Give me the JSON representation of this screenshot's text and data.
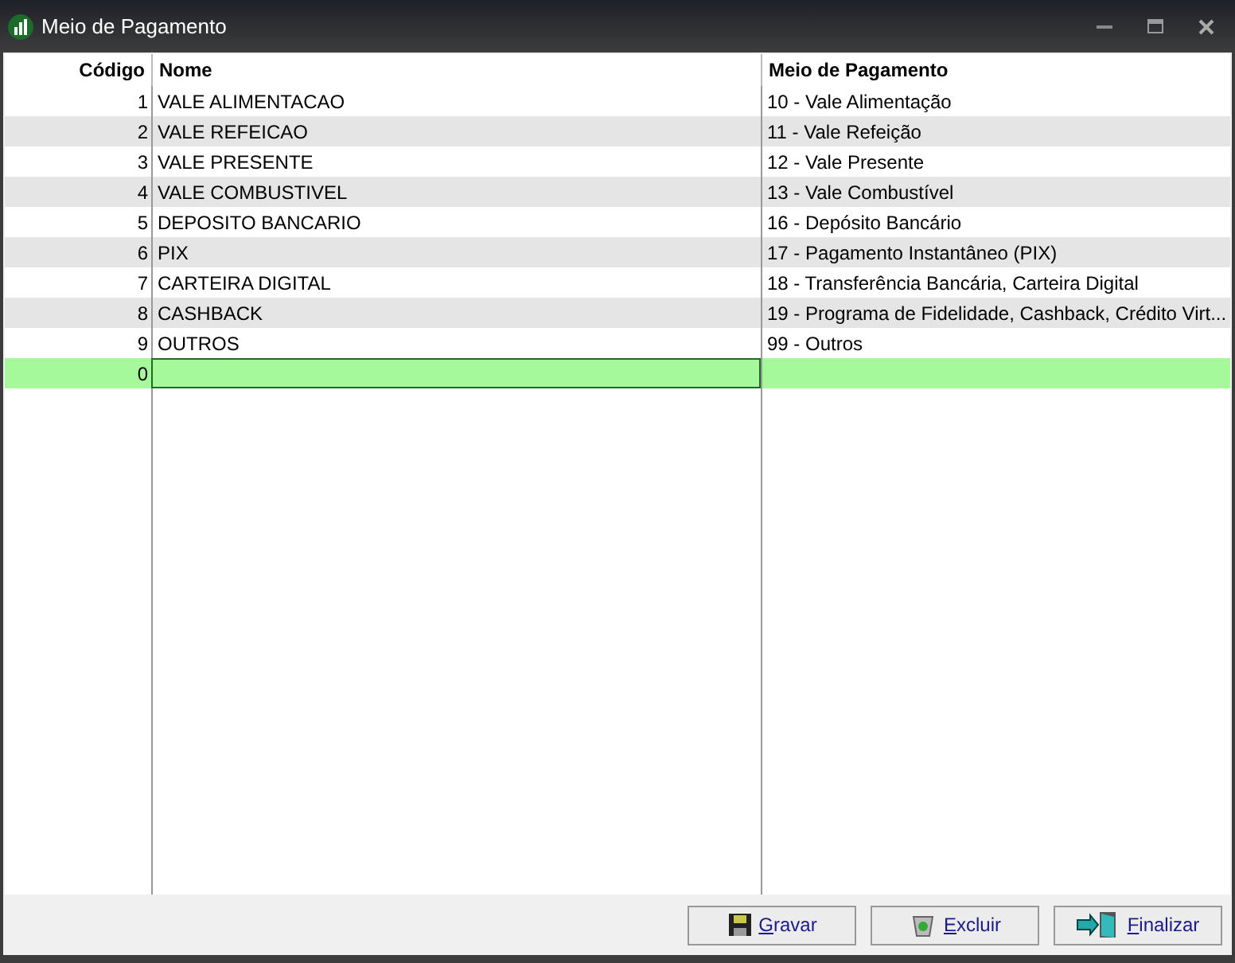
{
  "window": {
    "title": "Meio de Pagamento"
  },
  "table": {
    "columns": [
      "Código",
      "Nome",
      "Meio de Pagamento"
    ],
    "rows": [
      {
        "codigo": "1",
        "nome": "VALE ALIMENTACAO",
        "meio": "10 - Vale Alimentação",
        "selected": false
      },
      {
        "codigo": "2",
        "nome": "VALE REFEICAO",
        "meio": "11 - Vale Refeição",
        "selected": false
      },
      {
        "codigo": "3",
        "nome": "VALE PRESENTE",
        "meio": "12 - Vale Presente",
        "selected": false
      },
      {
        "codigo": "4",
        "nome": "VALE COMBUSTIVEL",
        "meio": "13 - Vale Combustível",
        "selected": false
      },
      {
        "codigo": "5",
        "nome": "DEPOSITO BANCARIO",
        "meio": "16 - Depósito Bancário",
        "selected": false
      },
      {
        "codigo": "6",
        "nome": "PIX",
        "meio": "17 - Pagamento Instantâneo (PIX)",
        "selected": false
      },
      {
        "codigo": "7",
        "nome": "CARTEIRA DIGITAL",
        "meio": "18 - Transferência Bancária, Carteira Digital",
        "selected": false
      },
      {
        "codigo": "8",
        "nome": "CASHBACK",
        "meio": "19 - Programa de Fidelidade, Cashback, Crédito Virt...",
        "selected": false
      },
      {
        "codigo": "9",
        "nome": "OUTROS",
        "meio": "99 - Outros",
        "selected": false
      },
      {
        "codigo": "0",
        "selected": true
      }
    ]
  },
  "buttons": [
    {
      "kind": "save",
      "label": "Gravar"
    },
    {
      "kind": "delete",
      "label": "Excluir"
    },
    {
      "kind": "exit",
      "label": "Finalizar"
    }
  ]
}
